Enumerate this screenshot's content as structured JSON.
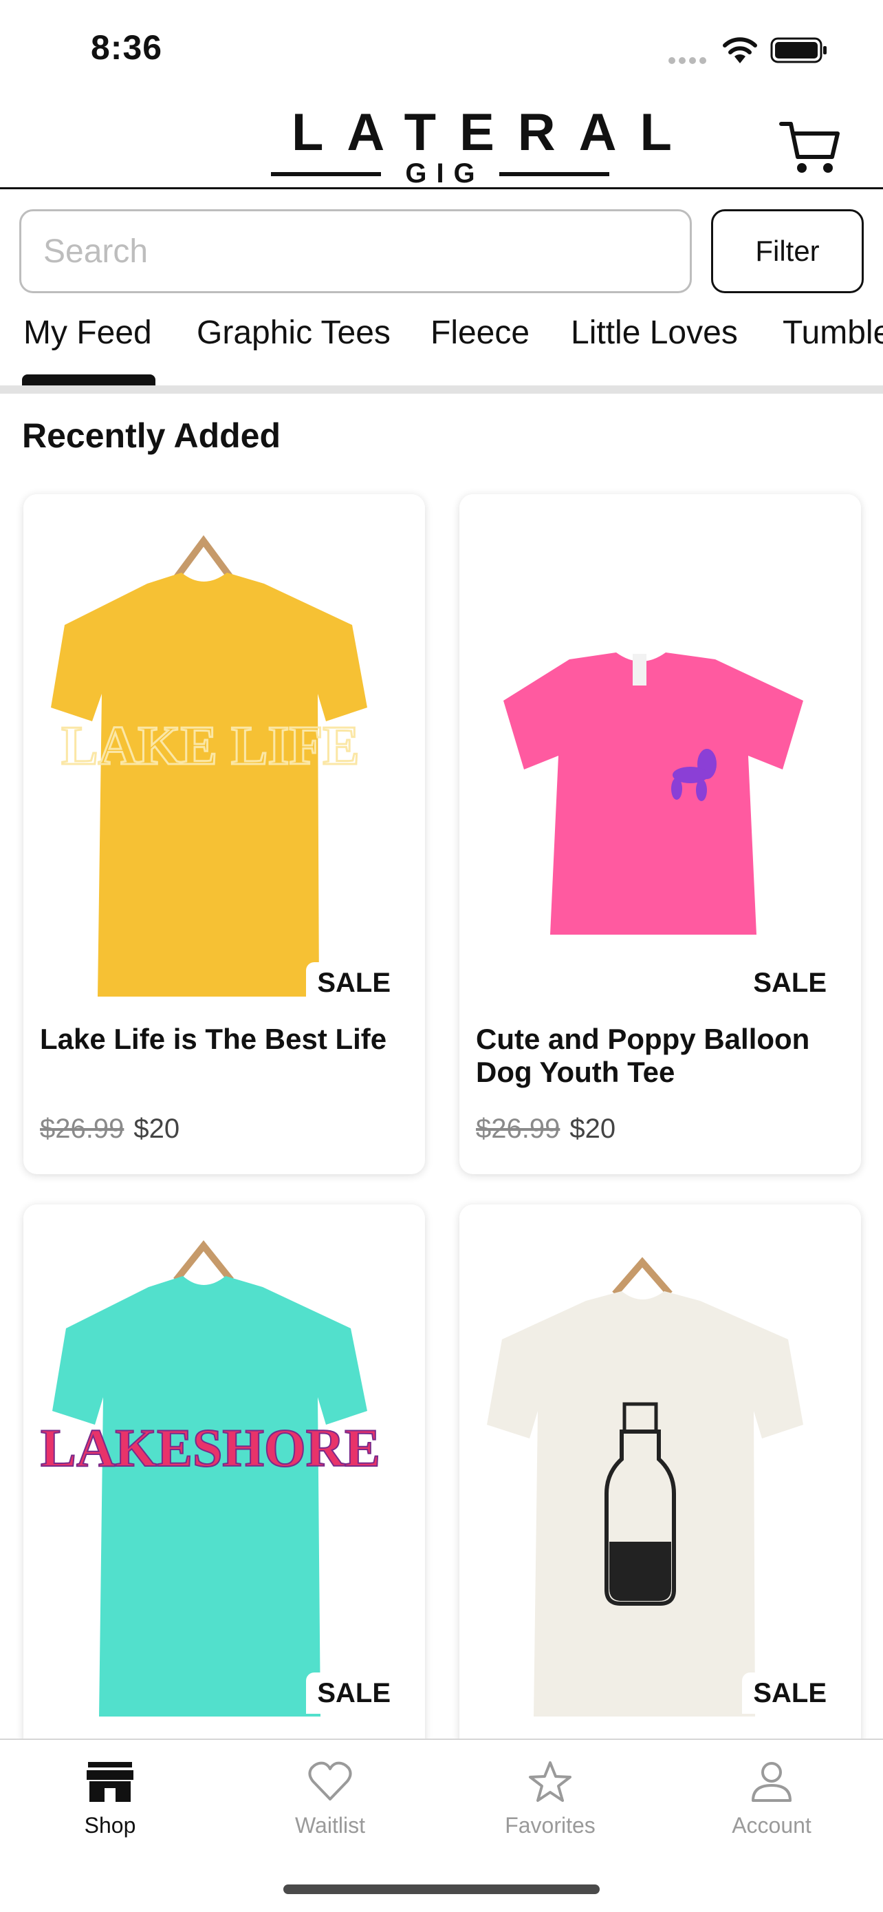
{
  "status_bar": {
    "time": "8:36"
  },
  "header": {
    "logo_main": "LATERAL",
    "logo_sub": "GIG",
    "cart_icon": "cart-icon"
  },
  "search": {
    "placeholder": "Search",
    "value": "",
    "filter_label": "Filter"
  },
  "tabs": [
    {
      "label": "My Feed",
      "active": true
    },
    {
      "label": "Graphic Tees",
      "active": false
    },
    {
      "label": "Fleece",
      "active": false
    },
    {
      "label": "Little Loves",
      "active": false
    },
    {
      "label": "Tumble",
      "active": false
    }
  ],
  "section": {
    "title": "Recently Added"
  },
  "products": [
    {
      "title": "Lake Life is The Best Life",
      "old_price": "$26.99",
      "new_price": "$20",
      "badge": "SALE",
      "shirt_color": "#f6c134",
      "print_text": "LAKE LIFE",
      "print_color": "#fbe7a6"
    },
    {
      "title": "Cute and Poppy Balloon Dog Youth Tee",
      "old_price": "$26.99",
      "new_price": "$20",
      "badge": "SALE",
      "shirt_color": "#ff5aa0",
      "print_text": "",
      "print_color": "#8b3fd6"
    },
    {
      "title": "",
      "old_price": "",
      "new_price": "",
      "badge": "SALE",
      "shirt_color": "#52e0cc",
      "print_text": "LAKESHORE",
      "print_color": "#e8336a"
    },
    {
      "title": "",
      "old_price": "",
      "new_price": "",
      "badge": "SALE",
      "shirt_color": "#f1eee6",
      "print_text": "",
      "print_color": "#222222"
    }
  ],
  "bottom_nav": [
    {
      "label": "Shop",
      "icon": "shop-icon",
      "active": true
    },
    {
      "label": "Waitlist",
      "icon": "heart-icon",
      "active": false
    },
    {
      "label": "Favorites",
      "icon": "star-icon",
      "active": false
    },
    {
      "label": "Account",
      "icon": "person-icon",
      "active": false
    }
  ]
}
